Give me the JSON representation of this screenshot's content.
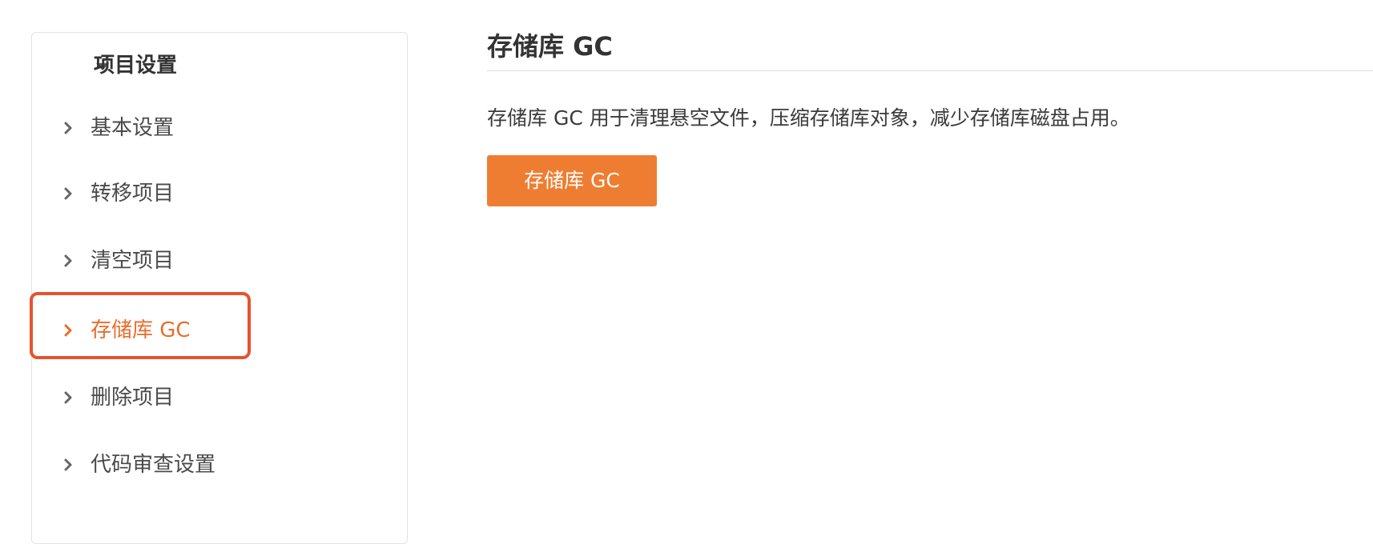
{
  "sidebar": {
    "group_title": "项目设置",
    "items": [
      {
        "label": "基本设置",
        "active": false
      },
      {
        "label": "转移项目",
        "active": false
      },
      {
        "label": "清空项目",
        "active": false
      },
      {
        "label": "存储库 GC",
        "active": true
      },
      {
        "label": "删除项目",
        "active": false
      },
      {
        "label": "代码审查设置",
        "active": false
      }
    ]
  },
  "main": {
    "title": "存储库 GC",
    "description": "存储库 GC 用于清理悬空文件，压缩存储库对象，减少存储库磁盘占用。",
    "button_label": "存储库 GC"
  },
  "colors": {
    "accent": "#ef7d31",
    "active_text": "#e96d2c",
    "highlight_border": "#e6532f"
  },
  "icons": {
    "group_caret": "caret-down-icon",
    "item_chevron": "chevron-right-icon"
  }
}
